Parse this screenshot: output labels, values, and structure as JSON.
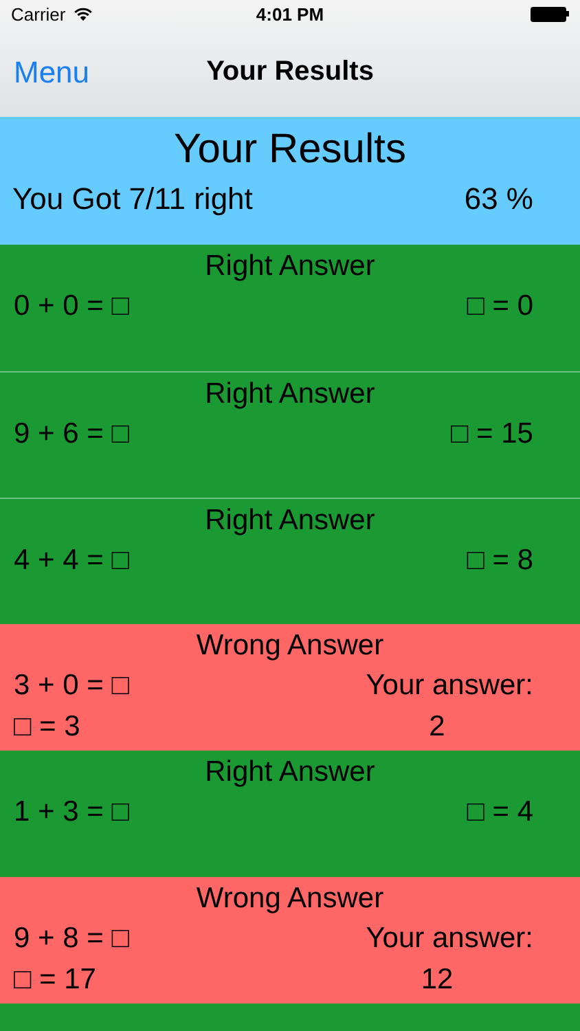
{
  "status_bar": {
    "carrier": "Carrier",
    "time": "4:01 PM"
  },
  "nav_bar": {
    "back": "Menu",
    "title": "Your Results"
  },
  "summary": {
    "title": "Your Results",
    "score": "You Got 7/11 right",
    "percent": "63 %"
  },
  "results": [
    {
      "kind": "right",
      "label": "Right Answer",
      "question": "0 + 0 = □",
      "answer": "□ = 0"
    },
    {
      "kind": "right",
      "label": "Right Answer",
      "question": "9 + 6 = □",
      "answer": "□ = 15"
    },
    {
      "kind": "right",
      "label": "Right Answer",
      "question": "4 + 4 = □",
      "answer": "□ = 8"
    },
    {
      "kind": "wrong",
      "label": "Wrong Answer",
      "question": "3 + 0 = □",
      "answer": "□ = 3",
      "your_label": "Your answer:",
      "your_answer": "2"
    },
    {
      "kind": "right",
      "label": "Right Answer",
      "question": "1 + 3 = □",
      "answer": "□ = 4"
    },
    {
      "kind": "wrong",
      "label": "Wrong Answer",
      "question": "9 + 8 = □",
      "answer": "□ = 17",
      "your_label": "Your answer:",
      "your_answer": "12"
    },
    {
      "kind": "right"
    }
  ]
}
